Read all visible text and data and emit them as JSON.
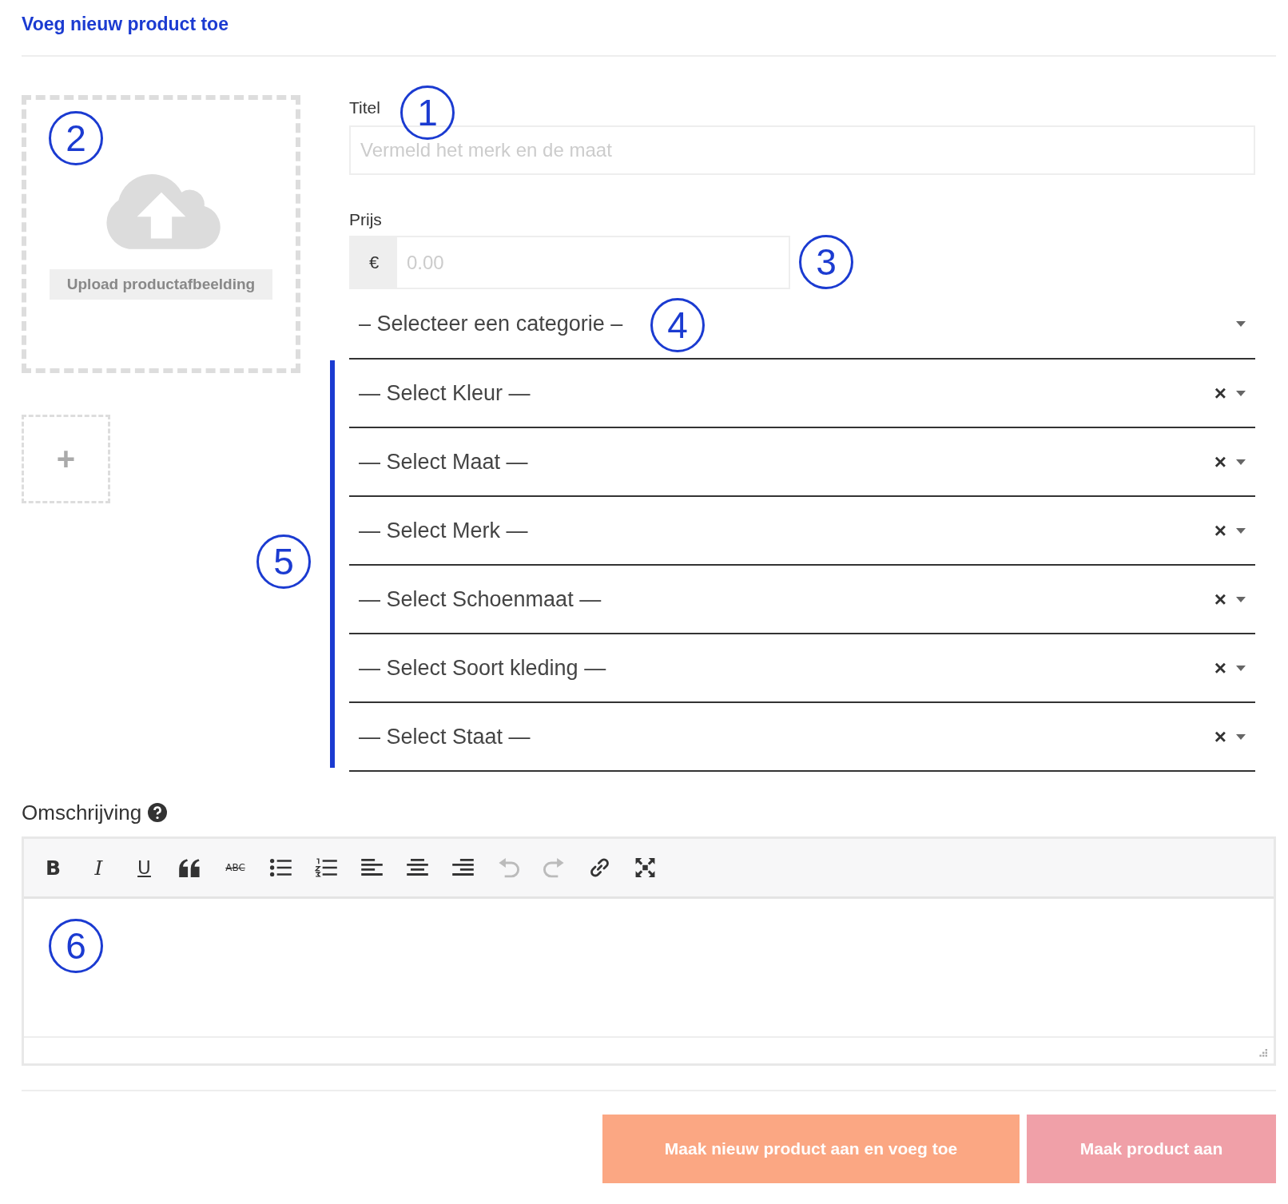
{
  "heading": "Voeg nieuw product toe",
  "upload": {
    "button": "Upload productafbeelding",
    "add": "+"
  },
  "title_field": {
    "label": "Titel",
    "placeholder": "Vermeld het merk en de maat"
  },
  "price_field": {
    "label": "Prijs",
    "prefix": "€",
    "placeholder": "0.00"
  },
  "category_select": {
    "value": "– Selecteer een categorie –"
  },
  "attribute_selects": [
    {
      "value": "— Select Kleur —",
      "clear": "×"
    },
    {
      "value": "— Select Maat —",
      "clear": "×"
    },
    {
      "value": "— Select Merk —",
      "clear": "×"
    },
    {
      "value": "— Select Schoenmaat —",
      "clear": "×"
    },
    {
      "value": "— Select Soort kleding —",
      "clear": "×"
    },
    {
      "value": "— Select Staat —",
      "clear": "×"
    }
  ],
  "description": {
    "label": "Omschrijving",
    "toolbar": [
      {
        "kind": "bold",
        "label": "B",
        "disabled": false
      },
      {
        "kind": "italic",
        "label": "I",
        "disabled": false
      },
      {
        "kind": "underline",
        "label": "U",
        "disabled": false
      },
      {
        "kind": "quote",
        "disabled": false
      },
      {
        "kind": "strike",
        "label": "ABC",
        "disabled": false
      },
      {
        "kind": "bullets",
        "disabled": false
      },
      {
        "kind": "numbers",
        "disabled": false
      },
      {
        "kind": "align-left",
        "disabled": false
      },
      {
        "kind": "align-center",
        "disabled": false
      },
      {
        "kind": "align-right",
        "disabled": false
      },
      {
        "kind": "undo",
        "disabled": true
      },
      {
        "kind": "redo",
        "disabled": true
      },
      {
        "kind": "link",
        "disabled": false
      },
      {
        "kind": "fullscreen",
        "disabled": false
      }
    ]
  },
  "buttons": [
    {
      "label": "Maak nieuw product aan en voeg toe",
      "disabled": false
    },
    {
      "label": "Maak product aan",
      "disabled": true
    }
  ],
  "callouts": [
    "1",
    "2",
    "3",
    "4",
    "5",
    "6"
  ]
}
